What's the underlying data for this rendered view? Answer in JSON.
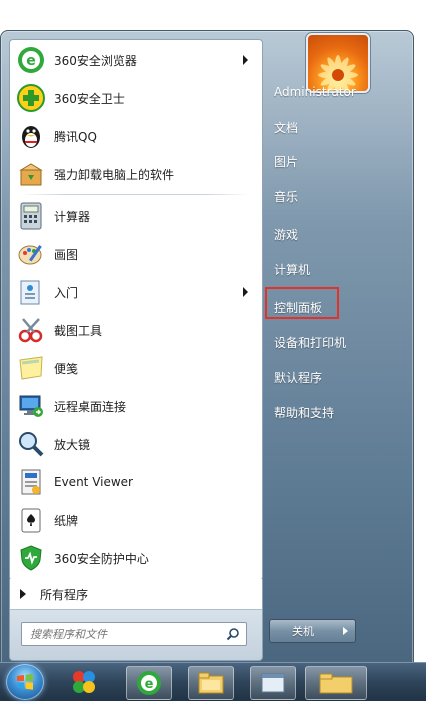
{
  "left_programs": [
    {
      "label": "360安全浏览器",
      "icon": "360-browser-icon",
      "has_submenu": true
    },
    {
      "label": "360安全卫士",
      "icon": "360-safe-icon",
      "has_submenu": false
    },
    {
      "label": "腾讯QQ",
      "icon": "qq-penguin-icon",
      "has_submenu": false
    },
    {
      "label": "强力卸载电脑上的软件",
      "icon": "uninstall-box-icon",
      "has_submenu": false
    },
    {
      "label": "计算器",
      "icon": "calculator-icon",
      "has_submenu": false
    },
    {
      "label": "画图",
      "icon": "paint-icon",
      "has_submenu": false
    },
    {
      "label": "入门",
      "icon": "getting-started-icon",
      "has_submenu": true
    },
    {
      "label": "截图工具",
      "icon": "snipping-tool-icon",
      "has_submenu": false
    },
    {
      "label": "便笺",
      "icon": "sticky-notes-icon",
      "has_submenu": false
    },
    {
      "label": "远程桌面连接",
      "icon": "remote-desktop-icon",
      "has_submenu": false
    },
    {
      "label": "放大镜",
      "icon": "magnifier-icon",
      "has_submenu": false
    },
    {
      "label": "Event Viewer",
      "icon": "event-viewer-icon",
      "has_submenu": false
    },
    {
      "label": "纸牌",
      "icon": "solitaire-icon",
      "has_submenu": false
    },
    {
      "label": "360安全防护中心",
      "icon": "360-shield-icon",
      "has_submenu": false
    }
  ],
  "all_programs_label": "所有程序",
  "search": {
    "placeholder": "搜索程序和文件"
  },
  "right_items": [
    {
      "label": "Administrator"
    },
    {
      "label": "文档"
    },
    {
      "label": "图片"
    },
    {
      "label": "音乐"
    },
    {
      "label": "游戏"
    },
    {
      "label": "计算机"
    },
    {
      "label": "控制面板",
      "highlighted": true
    },
    {
      "label": "设备和打印机"
    },
    {
      "label": "默认程序"
    },
    {
      "label": "帮助和支持"
    }
  ],
  "shutdown_label": "关机",
  "colors": {
    "highlight_border": "#e3322a",
    "menu_text_right": "#ffffff"
  }
}
